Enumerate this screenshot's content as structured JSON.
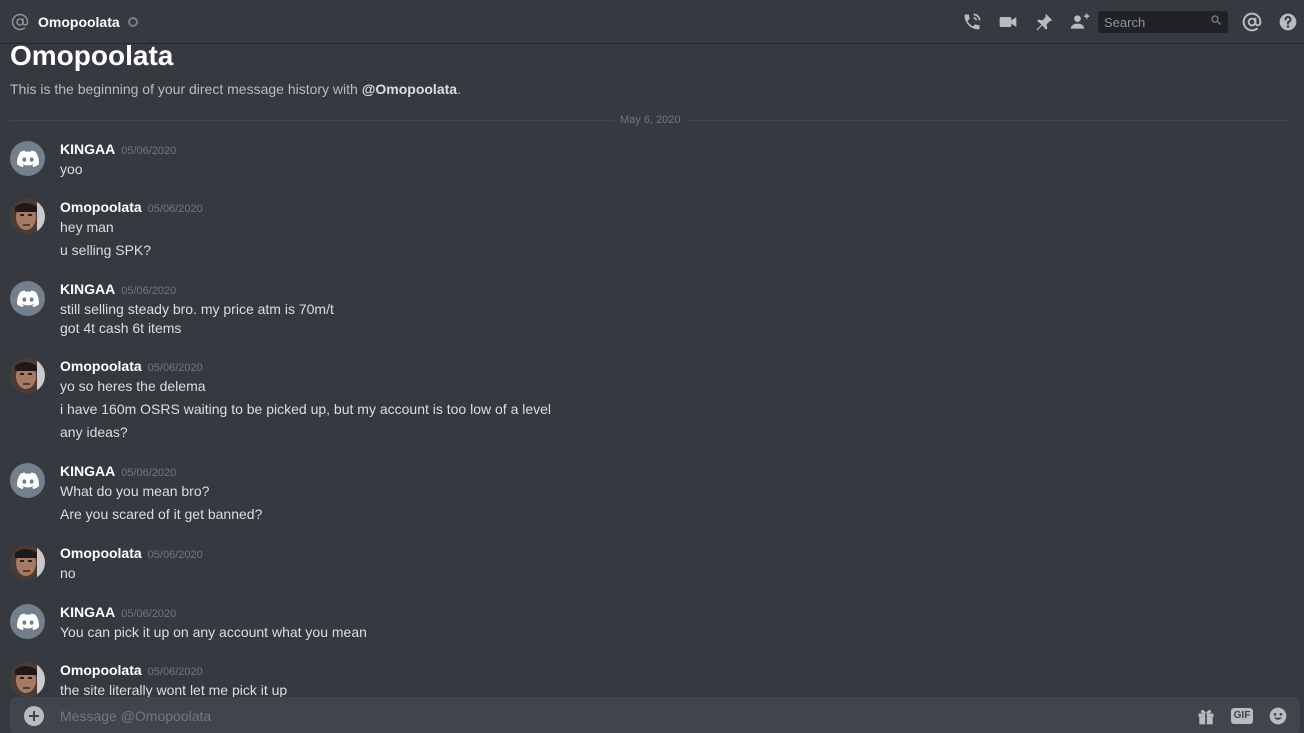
{
  "header": {
    "title": "Omopoolata",
    "search_placeholder": "Search"
  },
  "intro": {
    "title": "Omopoolata",
    "text_prefix": "This is the beginning of your direct message history with ",
    "mention": "@Omopoolata",
    "text_suffix": "."
  },
  "divider_date": "May 6, 2020",
  "messages": [
    {
      "author": "KINGAA",
      "timestamp": "05/06/2020",
      "lines": [
        "yoo"
      ]
    },
    {
      "author": "Omopoolata",
      "timestamp": "05/06/2020",
      "lines": [
        "hey man",
        "u selling SPK?"
      ]
    },
    {
      "author": "KINGAA",
      "timestamp": "05/06/2020",
      "lines": [
        "still selling steady bro. my price atm is 70m/t",
        "got 4t cash 6t items"
      ]
    },
    {
      "author": "Omopoolata",
      "timestamp": "05/06/2020",
      "lines": [
        "yo so heres the delema",
        "i have 160m OSRS waiting to be picked up, but my account is too low of a level",
        "any ideas?"
      ]
    },
    {
      "author": "KINGAA",
      "timestamp": "05/06/2020",
      "lines": [
        "What do you mean bro?",
        "Are you scared of it get banned?"
      ]
    },
    {
      "author": "Omopoolata",
      "timestamp": "05/06/2020",
      "lines": [
        "no"
      ]
    },
    {
      "author": "KINGAA",
      "timestamp": "05/06/2020",
      "lines": [
        "You can pick it up on any account what you mean"
      ]
    },
    {
      "author": "Omopoolata",
      "timestamp": "05/06/2020",
      "lines": [
        "the site literally wont let me pick it up"
      ]
    }
  ],
  "composer": {
    "placeholder": "Message @Omopoolata",
    "gif_label": "GIF"
  },
  "colors": {
    "background": "#36393f",
    "header_border": "#26282c",
    "composer_bg": "#40444b",
    "author": "#ffffff",
    "text": "#dcddde",
    "muted": "#72767d",
    "discord_avatar": "#747f8d"
  },
  "icons": {
    "header": [
      "at-icon",
      "status-dot-icon",
      "phone-call-icon",
      "video-call-icon",
      "pin-icon",
      "add-friend-icon",
      "search-icon",
      "mention-icon",
      "help-icon"
    ],
    "composer": [
      "add-attachment-icon",
      "gift-icon",
      "gif-icon",
      "emoji-icon"
    ]
  }
}
